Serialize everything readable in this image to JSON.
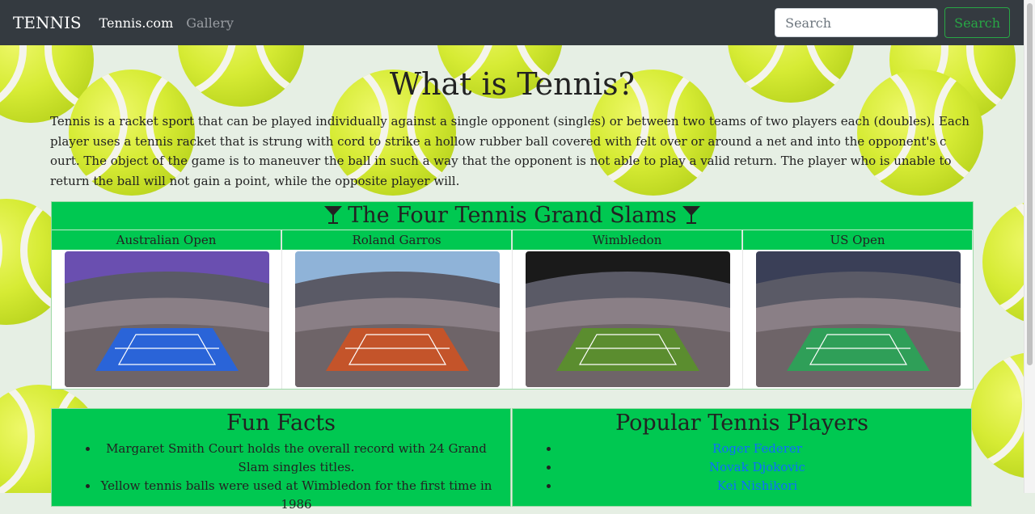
{
  "navbar": {
    "brand": "TENNIS",
    "links": [
      {
        "label": "Tennis.com",
        "active": true
      },
      {
        "label": "Gallery",
        "active": false
      }
    ],
    "search_placeholder": "Search",
    "search_button": "Search"
  },
  "main": {
    "title": "What is Tennis?",
    "intro": "Tennis is a racket sport that can be played individually against a single opponent (singles) or between two teams of two players each (doubles). Each player uses a tennis racket that is strung with cord to strike a hollow rubber ball covered with felt over or around a net and into the opponent's c ourt. The object of the game is to maneuver the ball in such a way that the opponent is not able to play a valid return. The player who is unable to return the ball will not gain a point, while the opposite player will."
  },
  "grand_slams": {
    "heading": "The Four Tennis Grand Slams",
    "icon": "trophy-icon",
    "tournaments": [
      {
        "name": "Australian Open",
        "court_color": "#2a64d8",
        "sky_color": "#6a4fb0"
      },
      {
        "name": "Roland Garros",
        "court_color": "#c4542a",
        "sky_color": "#8fb3d8"
      },
      {
        "name": "Wimbledon",
        "court_color": "#5b8d2f",
        "sky_color": "#1a1a1a"
      },
      {
        "name": "US Open",
        "court_color": "#2f9f58",
        "sky_color": "#3a3f57"
      }
    ]
  },
  "fun_facts": {
    "heading": "Fun Facts",
    "items": [
      "Margaret Smith Court holds the overall record with 24 Grand Slam singles titles.",
      "Yellow tennis balls were used at Wimbledon for the first time in 1986"
    ]
  },
  "players": {
    "heading": "Popular Tennis Players",
    "items": [
      "Roger Federer",
      "Novak Djokovic",
      "Kei Nishikori"
    ]
  },
  "colors": {
    "accent_green": "#00c851",
    "navbar": "#343a40",
    "link_blue": "#0d6efd"
  }
}
